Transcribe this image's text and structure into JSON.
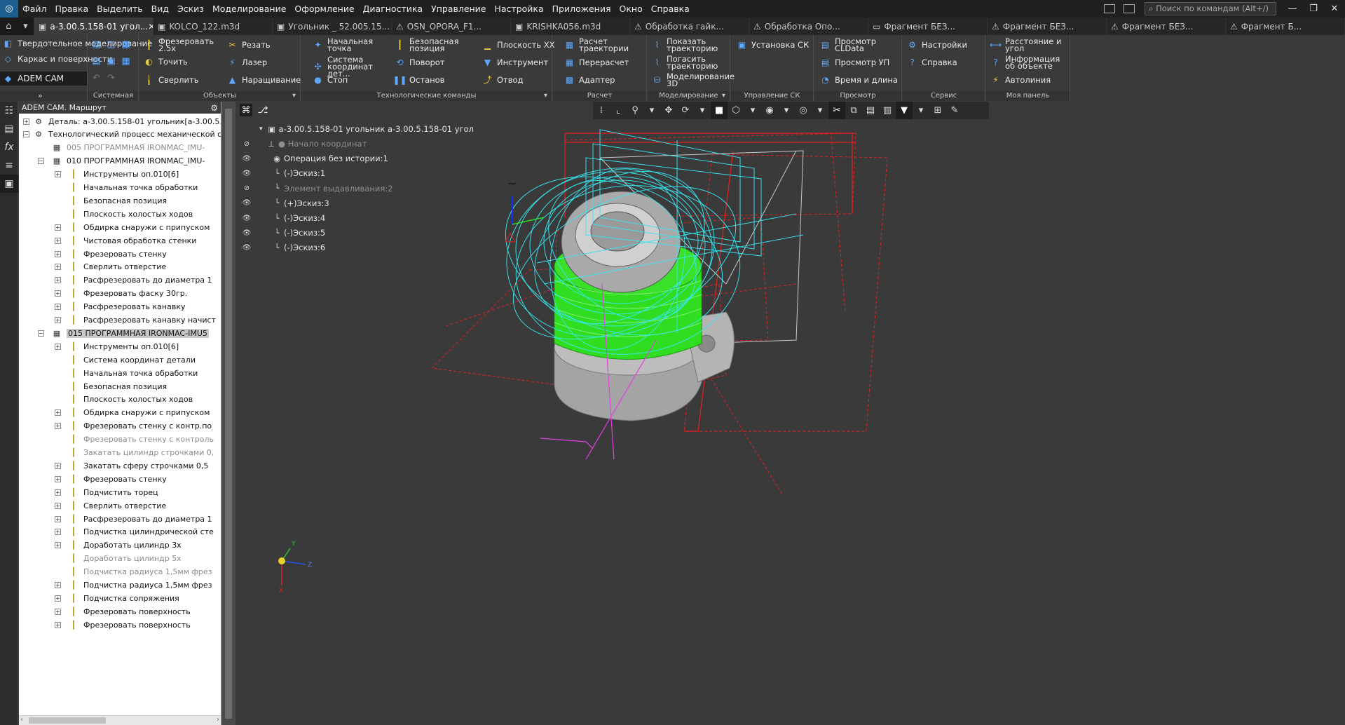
{
  "menubar": {
    "logo": "◎",
    "items": [
      "Файл",
      "Правка",
      "Выделить",
      "Вид",
      "Эскиз",
      "Моделирование",
      "Оформление",
      "Диагностика",
      "Управление",
      "Настройка",
      "Приложения",
      "Окно",
      "Справка"
    ],
    "search_placeholder": "Поиск по командам (Alt+/)"
  },
  "tabs": [
    {
      "label": "а-3.00.5.158-01 угол...",
      "active": true
    },
    {
      "label": "KOLCO_122.m3d"
    },
    {
      "label": "Угольник _ 52.005.15..."
    },
    {
      "label": "OSN_OPORA_F1..."
    },
    {
      "label": "KRISHKA056.m3d"
    },
    {
      "label": "Обработка гайк..."
    },
    {
      "label": "Обработка Опо..."
    },
    {
      "label": "Фрагмент БЕЗ..."
    },
    {
      "label": "Фрагмент БЕЗ..."
    },
    {
      "label": "Фрагмент БЕЗ..."
    },
    {
      "label": "Фрагмент Б..."
    }
  ],
  "ribbon": {
    "modes": [
      "Твердотельное моделирование",
      "Каркас и поверхности",
      "ADEM CAM"
    ],
    "groups": {
      "system": "Системная",
      "objects": "Объекты",
      "tech": "Технологические команды",
      "calc": "Расчет",
      "modeling": "Моделирование",
      "cs": "Управление СК",
      "view": "Просмотр",
      "service": "Сервис",
      "mypanel": "Моя панель"
    },
    "buttons": {
      "mill25": "Фрезеровать 2.5x",
      "turn": "Точить",
      "drill": "Сверлить",
      "cut": "Резать",
      "laser": "Лазер",
      "build": "Наращивание",
      "start_pt": "Начальная точка",
      "cs_part": "Система координат дет...",
      "stop": "Стоп",
      "safe_pos": "Безопасная позиция",
      "rotate": "Поворот",
      "halt": "Останов",
      "plane_xx": "Плоскость XX",
      "tool": "Инструмент",
      "retract": "Отвод",
      "calc_traj": "Расчет траектории",
      "recalc": "Перерасчет",
      "adapter": "Адаптер",
      "show_traj": "Показать траекторию",
      "hide_traj": "Погасить траекторию",
      "model3d": "Моделирование 3D",
      "set_cs": "Установка СК",
      "view_cldata": "Просмотр CLData",
      "view_up": "Просмотр УП",
      "time_len": "Время и длина",
      "settings": "Настройки",
      "help": "Справка",
      "dist_angle": "Расстояние и угол",
      "obj_info": "Информация об объекте",
      "autoline": "Автолиния"
    }
  },
  "route_panel": {
    "title": "ADEM CAM. Маршрут",
    "rows": [
      {
        "text": "Деталь: а-3.00.5.158-01 угольник[а-3.00.5.15",
        "level": 0,
        "exp": "+"
      },
      {
        "text": "Технологический процесс механической об",
        "level": 0,
        "exp": "-"
      },
      {
        "text": "005  ПРОГРАММНАЯ IRONMAC_IMU-",
        "level": 1,
        "exp": "",
        "dim": true
      },
      {
        "text": "010  ПРОГРАММНАЯ IRONMAC_IMU-",
        "level": 1,
        "exp": "-"
      },
      {
        "text": "Инструменты оп.010[6]",
        "level": 2,
        "exp": "+"
      },
      {
        "text": "Начальная точка обработки",
        "level": 2,
        "exp": ""
      },
      {
        "text": "Безопасная позиция",
        "level": 2,
        "exp": ""
      },
      {
        "text": "Плоскость холостых ходов",
        "level": 2,
        "exp": ""
      },
      {
        "text": "Обдирка снаружи с припуском",
        "level": 2,
        "exp": "+"
      },
      {
        "text": "Чистовая обработка стенки",
        "level": 2,
        "exp": "+"
      },
      {
        "text": "Фрезеровать стенку",
        "level": 2,
        "exp": "+"
      },
      {
        "text": "Сверлить отверстие",
        "level": 2,
        "exp": "+"
      },
      {
        "text": "Расфрезеровать до диаметра 1",
        "level": 2,
        "exp": "+"
      },
      {
        "text": "Фрезеровать фаску 30гр.",
        "level": 2,
        "exp": "+"
      },
      {
        "text": "Расфрезеровать канавку",
        "level": 2,
        "exp": "+"
      },
      {
        "text": "Расфрезеровать канавку начист",
        "level": 2,
        "exp": "+"
      },
      {
        "text": "015  ПРОГРАММНАЯ IRONMAC-IMU5",
        "level": 1,
        "exp": "-",
        "sel": true
      },
      {
        "text": "Инструменты оп.010[6]",
        "level": 2,
        "exp": "+"
      },
      {
        "text": "Система координат детали",
        "level": 2,
        "exp": ""
      },
      {
        "text": "Начальная точка обработки",
        "level": 2,
        "exp": ""
      },
      {
        "text": "Безопасная позиция",
        "level": 2,
        "exp": ""
      },
      {
        "text": "Плоскость холостых ходов",
        "level": 2,
        "exp": ""
      },
      {
        "text": "Обдирка снаружи с припуском",
        "level": 2,
        "exp": "+"
      },
      {
        "text": "Фрезеровать стенку с контр.по",
        "level": 2,
        "exp": "+"
      },
      {
        "text": "Фрезеровать стенку с контроль",
        "level": 2,
        "exp": "",
        "dim": true
      },
      {
        "text": "Закатать цилиндр строчками 0,",
        "level": 2,
        "exp": "",
        "dim": true
      },
      {
        "text": "Закатать сферу строчками 0,5",
        "level": 2,
        "exp": "+"
      },
      {
        "text": "Фрезеровать стенку",
        "level": 2,
        "exp": "+"
      },
      {
        "text": "Подчистить торец",
        "level": 2,
        "exp": "+"
      },
      {
        "text": "Сверлить отверстие",
        "level": 2,
        "exp": "+"
      },
      {
        "text": "Расфрезеровать до диаметра 1",
        "level": 2,
        "exp": "+"
      },
      {
        "text": "Подчистка цилиндрической сте",
        "level": 2,
        "exp": "+"
      },
      {
        "text": "Доработать цилиндр 3х",
        "level": 2,
        "exp": "+"
      },
      {
        "text": "Доработать цилиндр 5х",
        "level": 2,
        "exp": "",
        "dim": true
      },
      {
        "text": "Подчистка радиуса 1,5мм фрез",
        "level": 2,
        "exp": "",
        "dim": true
      },
      {
        "text": "Подчистка радиуса 1,5мм фрез",
        "level": 2,
        "exp": "+"
      },
      {
        "text": "Подчистка сопряжения",
        "level": 2,
        "exp": "+"
      },
      {
        "text": "Фрезеровать поверхность",
        "level": 2,
        "exp": "+"
      },
      {
        "text": "Фрезеровать поверхность",
        "level": 2,
        "exp": "+"
      }
    ]
  },
  "model_tree": {
    "root": "а-3.00.5.158-01 угольник а-3.00.5.158-01 угол",
    "items": [
      {
        "text": "Начало координат",
        "dim": true,
        "eye": "hidden"
      },
      {
        "text": "Операция без истории:1",
        "dim": false,
        "eye": "visible"
      },
      {
        "text": "(-)Эскиз:1",
        "dim": false,
        "eye": "visible"
      },
      {
        "text": "Элемент выдавливания:2",
        "dim": true,
        "eye": "hidden"
      },
      {
        "text": "(+)Эскиз:3",
        "dim": false,
        "eye": "visible"
      },
      {
        "text": "(-)Эскиз:4",
        "dim": false,
        "eye": "visible"
      },
      {
        "text": "(-)Эскиз:5",
        "dim": false,
        "eye": "visible"
      },
      {
        "text": "(-)Эскиз:6",
        "dim": false,
        "eye": "visible"
      }
    ]
  },
  "colors": {
    "toolpath": "#38e6f0",
    "part_green": "#30dd20",
    "part_grey": "#a8a8a8",
    "sketch_red": "#e02020",
    "axis_magenta": "#e040e0"
  }
}
